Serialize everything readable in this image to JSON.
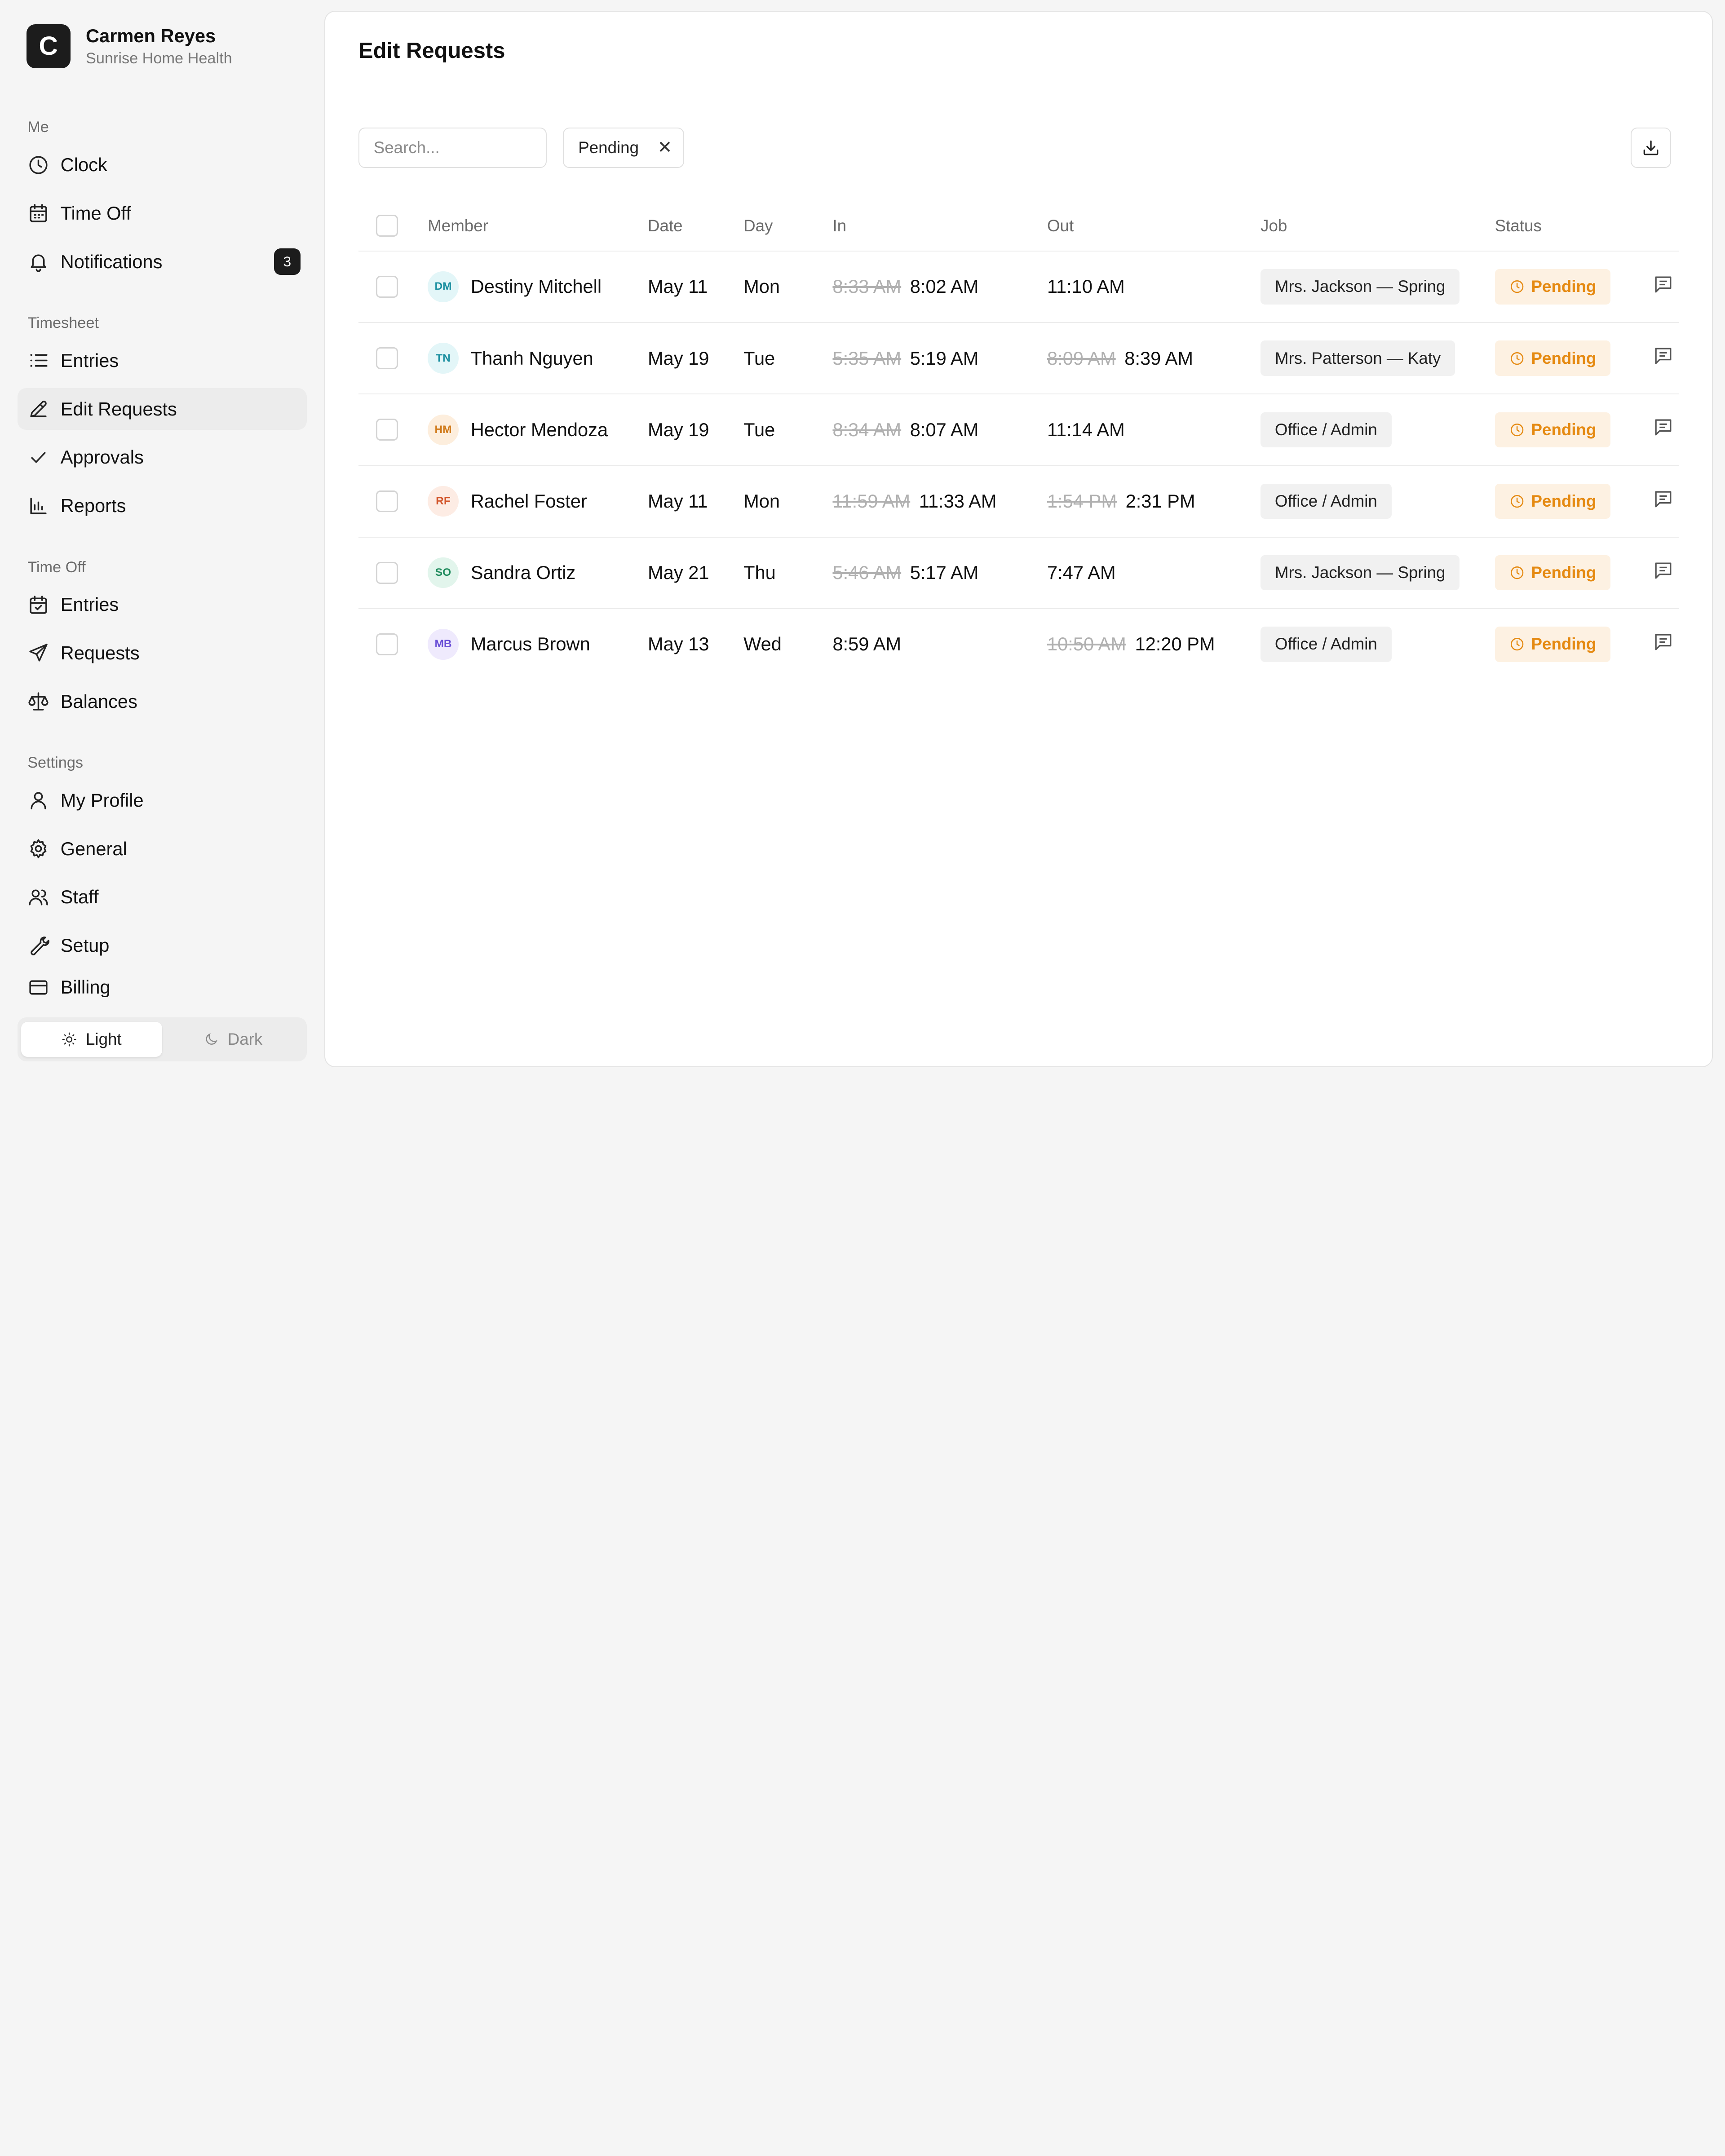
{
  "brand": {
    "name": "Carmen Reyes",
    "org": "Sunrise Home Health",
    "logo_letter": "C"
  },
  "sidebar": {
    "sections": [
      {
        "label": "Me"
      },
      {
        "label": "Timesheet"
      },
      {
        "label": "Time Off"
      },
      {
        "label": "Settings"
      }
    ],
    "me": [
      {
        "label": "Clock",
        "icon": "clock-icon"
      },
      {
        "label": "Time Off",
        "icon": "calendar-icon"
      },
      {
        "label": "Notifications",
        "icon": "bell-icon",
        "badge": "3"
      }
    ],
    "timesheet": [
      {
        "label": "Entries",
        "icon": "list-icon"
      },
      {
        "label": "Edit Requests",
        "icon": "pencil-icon",
        "active": true
      },
      {
        "label": "Approvals",
        "icon": "check-icon"
      },
      {
        "label": "Reports",
        "icon": "bar-chart-icon"
      }
    ],
    "timeoff": [
      {
        "label": "Entries",
        "icon": "calendar-check-icon"
      },
      {
        "label": "Requests",
        "icon": "send-icon"
      },
      {
        "label": "Balances",
        "icon": "scale-icon"
      }
    ],
    "settings": [
      {
        "label": "My Profile",
        "icon": "user-icon"
      },
      {
        "label": "General",
        "icon": "gear-icon"
      },
      {
        "label": "Staff",
        "icon": "users-icon"
      },
      {
        "label": "Setup",
        "icon": "wrench-icon"
      },
      {
        "label": "Billing",
        "icon": "credit-card-icon"
      }
    ],
    "theme": {
      "light": "Light",
      "dark": "Dark",
      "selected": "Light"
    }
  },
  "main": {
    "title": "Edit Requests",
    "search_placeholder": "Search...",
    "filter_chip": "Pending",
    "columns": [
      "Member",
      "Date",
      "Day",
      "In",
      "Out",
      "Job",
      "Status"
    ],
    "rows": [
      {
        "initials": "DM",
        "name": "Destiny Mitchell",
        "date": "May 11",
        "day": "Mon",
        "in_old": "8:33 AM",
        "in": "8:02 AM",
        "out_old": "",
        "out": "11:10 AM",
        "job": "Mrs. Jackson — Spring",
        "status": "Pending",
        "avatar_bg": "#e3f6f8",
        "avatar_fg": "#1a8fa0"
      },
      {
        "initials": "TN",
        "name": "Thanh Nguyen",
        "date": "May 19",
        "day": "Tue",
        "in_old": "5:35 AM",
        "in": "5:19 AM",
        "out_old": "8:09 AM",
        "out": "8:39 AM",
        "job": "Mrs. Patterson — Katy",
        "status": "Pending",
        "avatar_bg": "#e3f6f8",
        "avatar_fg": "#1a8fa0"
      },
      {
        "initials": "HM",
        "name": "Hector Mendoza",
        "date": "May 19",
        "day": "Tue",
        "in_old": "8:34 AM",
        "in": "8:07 AM",
        "out_old": "",
        "out": "11:14 AM",
        "job": "Office / Admin",
        "status": "Pending",
        "avatar_bg": "#fdeedd",
        "avatar_fg": "#d07a1a"
      },
      {
        "initials": "RF",
        "name": "Rachel Foster",
        "date": "May 11",
        "day": "Mon",
        "in_old": "11:59 AM",
        "in": "11:33 AM",
        "out_old": "1:54 PM",
        "out": "2:31 PM",
        "job": "Office / Admin",
        "status": "Pending",
        "avatar_bg": "#fdece4",
        "avatar_fg": "#d2552a"
      },
      {
        "initials": "SO",
        "name": "Sandra Ortiz",
        "date": "May 21",
        "day": "Thu",
        "in_old": "5:46 AM",
        "in": "5:17 AM",
        "out_old": "",
        "out": "7:47 AM",
        "job": "Mrs. Jackson — Spring",
        "status": "Pending",
        "avatar_bg": "#e2f5ec",
        "avatar_fg": "#1e8a5c"
      },
      {
        "initials": "MB",
        "name": "Marcus Brown",
        "date": "May 13",
        "day": "Wed",
        "in_old": "",
        "in": "8:59 AM",
        "out_old": "10:50 AM",
        "out": "12:20 PM",
        "job": "Office / Admin",
        "status": "Pending",
        "avatar_bg": "#efeafd",
        "avatar_fg": "#6a4fd6"
      }
    ]
  },
  "colors": {
    "accent": "#1c1c1c",
    "pending_bg": "#fdf1e2",
    "pending_fg": "#e58a12"
  }
}
